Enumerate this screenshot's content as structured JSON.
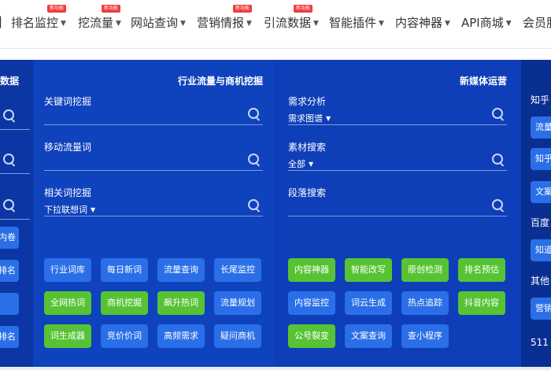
{
  "nav": {
    "items": [
      {
        "label": "排名监控",
        "badge": "新功能"
      },
      {
        "label": "挖流量",
        "badge": "新功能"
      },
      {
        "label": "网站查询",
        "badge": ""
      },
      {
        "label": "营销情报",
        "badge": "新功能"
      },
      {
        "label": "引流数据",
        "badge": "新功能"
      },
      {
        "label": "智能插件",
        "badge": ""
      },
      {
        "label": "内容神器",
        "badge": ""
      },
      {
        "label": "API商城",
        "badge": ""
      },
      {
        "label": "会员服",
        "badge": ""
      }
    ]
  },
  "left_panel": {
    "title_fragment": "数据",
    "tags": [
      "内卷",
      "排名",
      "",
      "排名"
    ]
  },
  "mid_panel": {
    "title": "行业流量与商机挖掘",
    "rows": [
      {
        "label": "关键词挖掘",
        "sub": ""
      },
      {
        "label": "移动流量词",
        "sub": ""
      },
      {
        "label": "相关词挖掘",
        "sub": "下拉联想词"
      }
    ],
    "tags": [
      {
        "label": "行业词库",
        "color": "blue"
      },
      {
        "label": "每日新词",
        "color": "blue"
      },
      {
        "label": "流量查询",
        "color": "blue"
      },
      {
        "label": "长尾监控",
        "color": "blue"
      },
      {
        "label": "全网热词",
        "color": "green"
      },
      {
        "label": "商机挖掘",
        "color": "green"
      },
      {
        "label": "飙升热词",
        "color": "green"
      },
      {
        "label": "流量规划",
        "color": "blue"
      },
      {
        "label": "词生成器",
        "color": "green"
      },
      {
        "label": "竞价价词",
        "color": "blue"
      },
      {
        "label": "高频需求",
        "color": "blue"
      },
      {
        "label": "疑问商机",
        "color": "blue"
      }
    ]
  },
  "right_panel": {
    "title": "新媒体运营",
    "rows": [
      {
        "label": "需求分析",
        "sub": "需求图谱"
      },
      {
        "label": "素材搜索",
        "sub": "全部"
      },
      {
        "label": "段落搜索",
        "sub": ""
      }
    ],
    "tags": [
      {
        "label": "内容神器",
        "color": "green"
      },
      {
        "label": "智能改写",
        "color": "green"
      },
      {
        "label": "原创检测",
        "color": "green"
      },
      {
        "label": "排名预估",
        "color": "green"
      },
      {
        "label": "内容监控",
        "color": "blue"
      },
      {
        "label": "词云生成",
        "color": "blue"
      },
      {
        "label": "热点追踪",
        "color": "blue"
      },
      {
        "label": "抖音内容",
        "color": "green"
      },
      {
        "label": "公号裂变",
        "color": "green"
      },
      {
        "label": "文案查询",
        "color": "blue"
      },
      {
        "label": "查小程序",
        "color": "blue"
      }
    ]
  },
  "far_panel": {
    "items": [
      "知乎",
      "流量",
      "知乎",
      "文案",
      "百度",
      "知道",
      "其他",
      "营销",
      "511"
    ]
  },
  "colors": {
    "nav_text": "#333333",
    "panel_blue": "#0f42bd",
    "tag_blue": "#2a6fe8",
    "tag_green": "#57c334",
    "badge_red": "#f23b3b"
  },
  "icons": [
    "search-icon",
    "caret-down-icon"
  ]
}
